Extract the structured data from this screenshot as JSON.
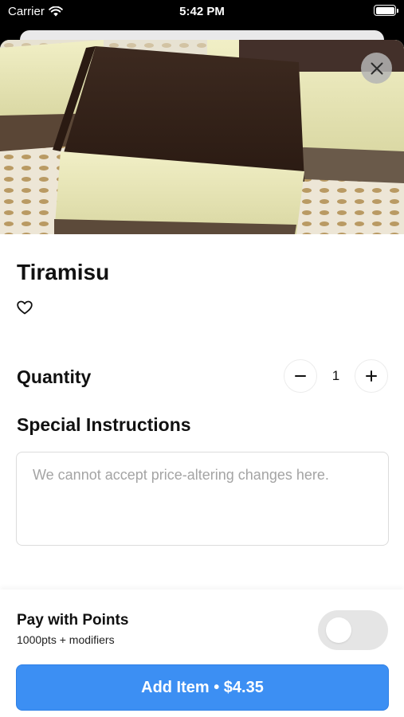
{
  "status_bar": {
    "carrier": "Carrier",
    "time": "5:42 PM"
  },
  "item": {
    "title": "Tiramisu",
    "image_alt": "tiramisu-slice-photo"
  },
  "quantity": {
    "label": "Quantity",
    "value": "1",
    "decrement_symbol": "−",
    "increment_symbol": "+"
  },
  "instructions": {
    "label": "Special Instructions",
    "placeholder": "We cannot accept price-altering changes here.",
    "value": ""
  },
  "points": {
    "title": "Pay with Points",
    "subtitle": "1000pts + modifiers",
    "enabled": false
  },
  "cta": {
    "label": "Add Item • $4.35"
  },
  "colors": {
    "accent": "#3c8ff3",
    "toggle_off": "#e5e5e5"
  },
  "icons": {
    "close": "close-icon",
    "favorite": "heart-outline-icon",
    "wifi": "wifi-icon",
    "battery": "battery-icon"
  }
}
